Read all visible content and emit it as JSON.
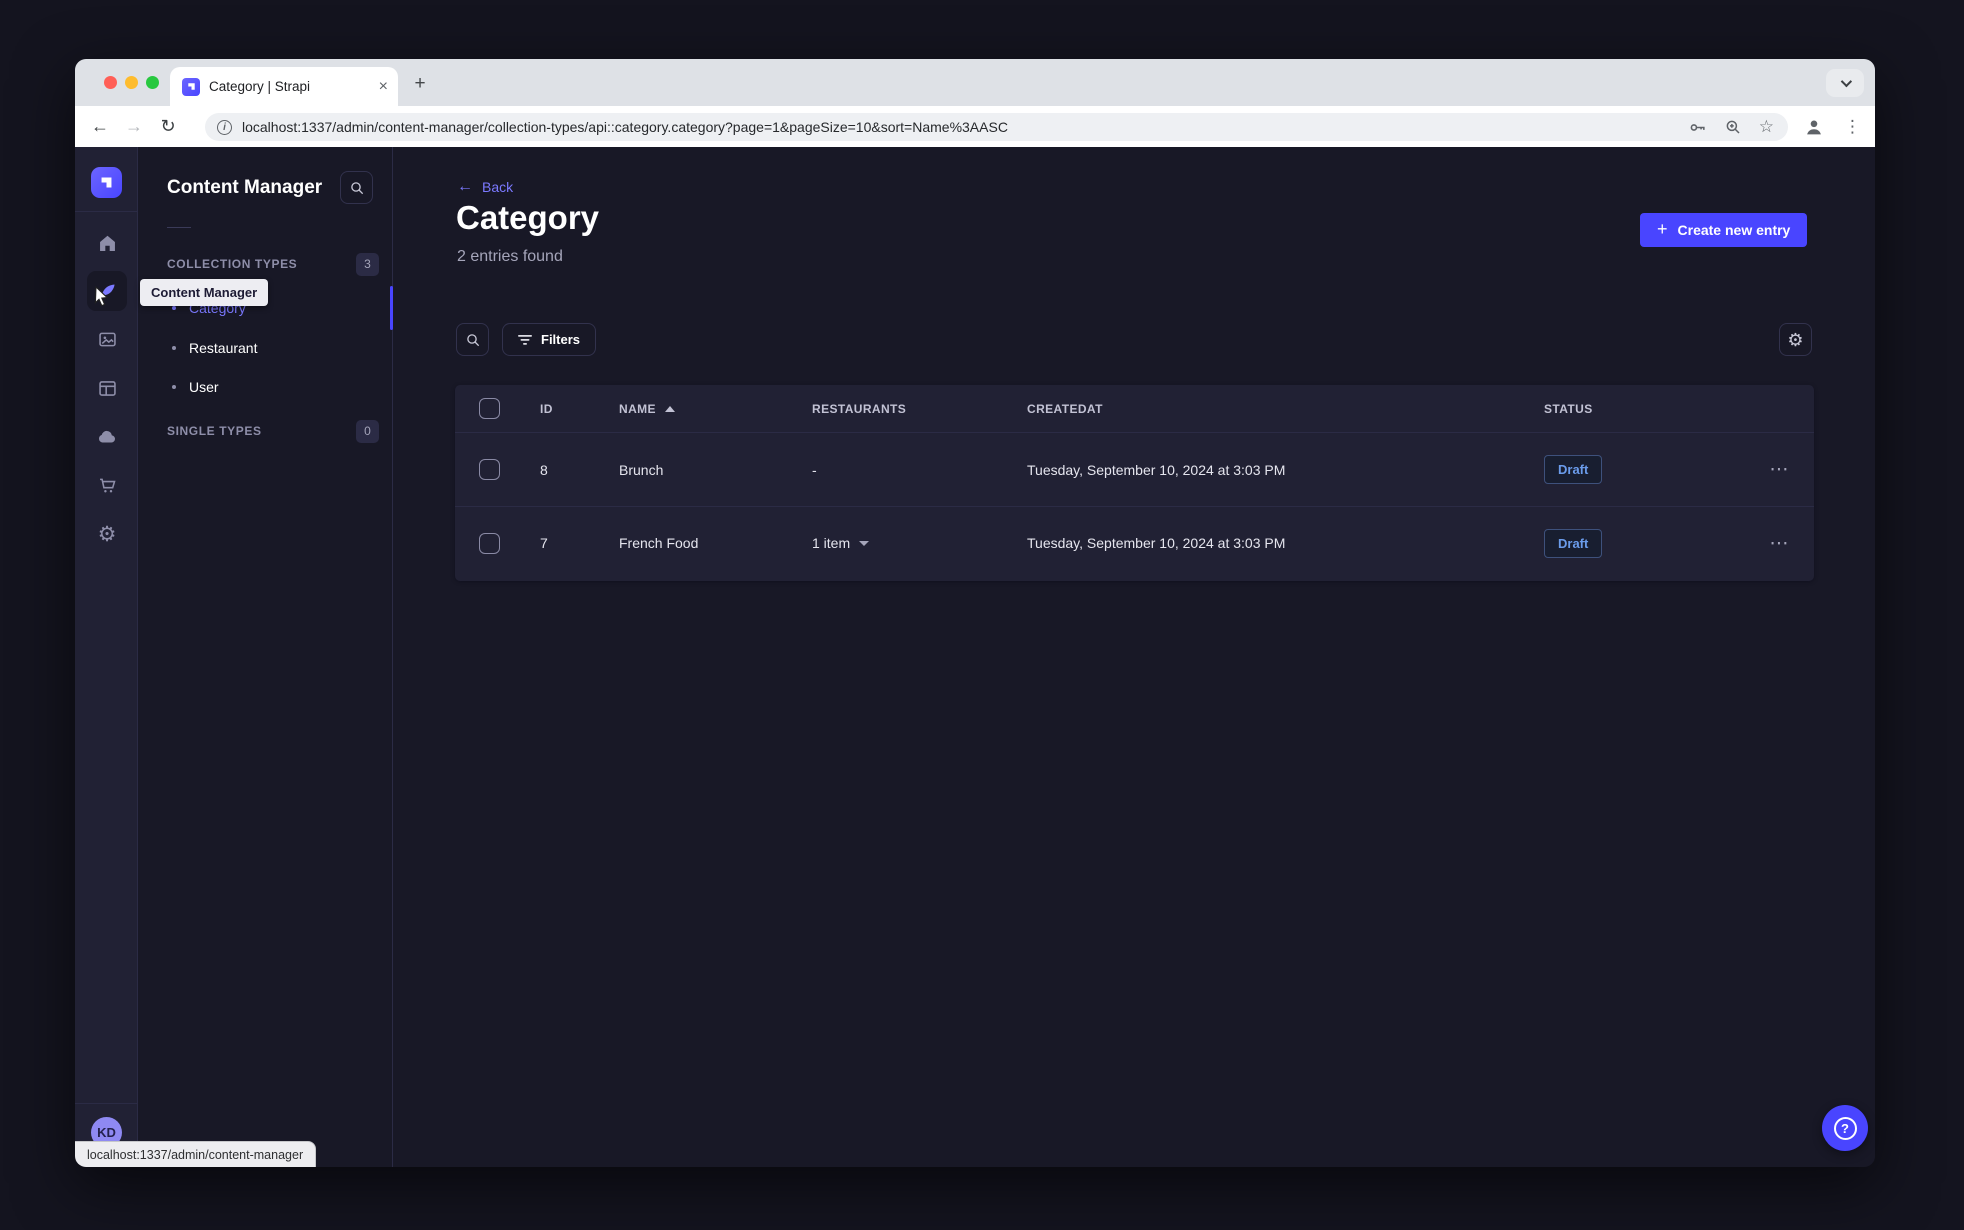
{
  "browser": {
    "tab_title": "Category | Strapi",
    "url": "localhost:1337/admin/content-manager/collection-types/api::category.category?page=1&pageSize=10&sort=Name%3AASC",
    "status_bar_link": "localhost:1337/admin/content-manager"
  },
  "glyphs": {
    "close_tab": "×",
    "new_tab": "+",
    "back_arrow": "←",
    "forward_arrow": "→",
    "reload": "↻",
    "info": "i",
    "star": "☆",
    "kebab_vertical": "⋮",
    "kebab_horizontal": "⋯",
    "gear": "⚙",
    "plus": "+",
    "help": "?"
  },
  "nav_sidebar": {
    "avatar_initials": "KD"
  },
  "sub_sidebar": {
    "title": "Content Manager",
    "sections": [
      {
        "label": "COLLECTION TYPES",
        "count": "3",
        "items": [
          {
            "label": "Category",
            "active": true
          },
          {
            "label": "Restaurant",
            "active": false
          },
          {
            "label": "User",
            "active": false
          }
        ]
      },
      {
        "label": "SINGLE TYPES",
        "count": "0",
        "items": []
      }
    ]
  },
  "tooltip": {
    "text": "Content Manager"
  },
  "main": {
    "back_label": "Back",
    "title": "Category",
    "subtitle": "2 entries found",
    "create_button_label": "Create new entry",
    "filters_label": "Filters"
  },
  "table": {
    "headers": {
      "id": "ID",
      "name": "NAME",
      "restaurants": "RESTAURANTS",
      "createdat": "CREATEDAT",
      "status": "STATUS"
    },
    "rows": [
      {
        "id": "8",
        "name": "Brunch",
        "restaurants": "-",
        "createdat": "Tuesday, September 10, 2024 at 3:03 PM",
        "status": "Draft"
      },
      {
        "id": "7",
        "name": "French Food",
        "restaurants": "1 item",
        "createdat": "Tuesday, September 10, 2024 at 3:03 PM",
        "status": "Draft"
      }
    ]
  },
  "colors": {
    "primary": "#4945ff",
    "primary_light": "#7b79ff",
    "app_bg": "#181826",
    "panel_bg": "#212134",
    "border": "#2b2b45",
    "border_light": "#32324d",
    "text_muted": "#a5a5ba",
    "text_faint": "#8e8ea9",
    "draft_text": "#6b9ceb",
    "draft_border": "#3e517c",
    "chrome_bg": "#dee1e6",
    "light_close": "#ff5f57",
    "light_min": "#febc2e",
    "light_max": "#28c840",
    "avatar_bg": "#8e89f2"
  }
}
